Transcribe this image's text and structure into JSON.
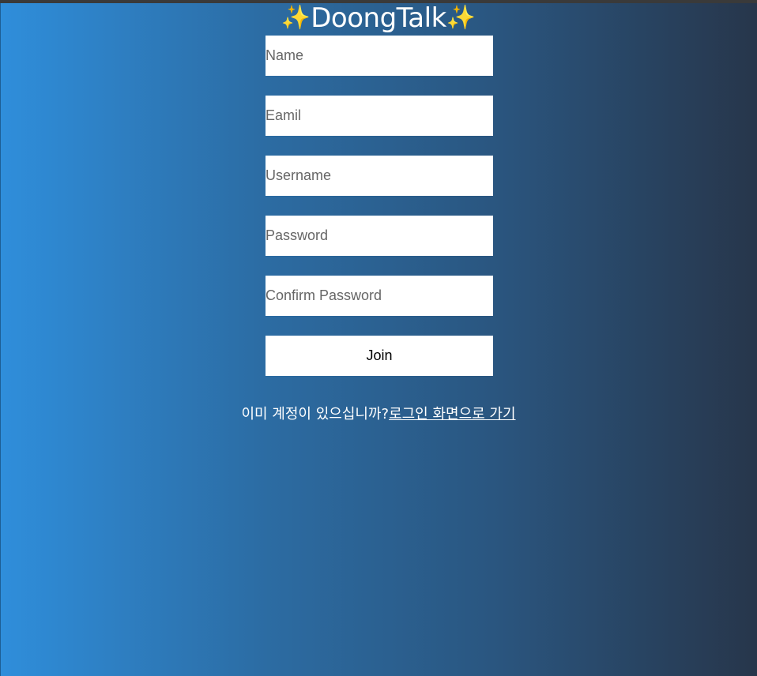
{
  "header": {
    "sparkle_left": "✨",
    "title": "DoongTalk",
    "sparkle_right": "✨"
  },
  "form": {
    "name_placeholder": "Name",
    "email_placeholder": "Eamil",
    "username_placeholder": "Username",
    "password_placeholder": "Password",
    "confirm_password_placeholder": "Confirm Password",
    "join_label": "Join"
  },
  "footer": {
    "prompt_text": "이미 계정이 있으십니까?",
    "login_link_text": "로그인 화면으로 가기"
  },
  "colors": {
    "gradient_start": "#2f8edb",
    "gradient_end": "#27364b",
    "field_background": "#ffffff",
    "sparkle": "#ffd24a"
  },
  "icons": {
    "sparkle": "sparkles-icon"
  }
}
